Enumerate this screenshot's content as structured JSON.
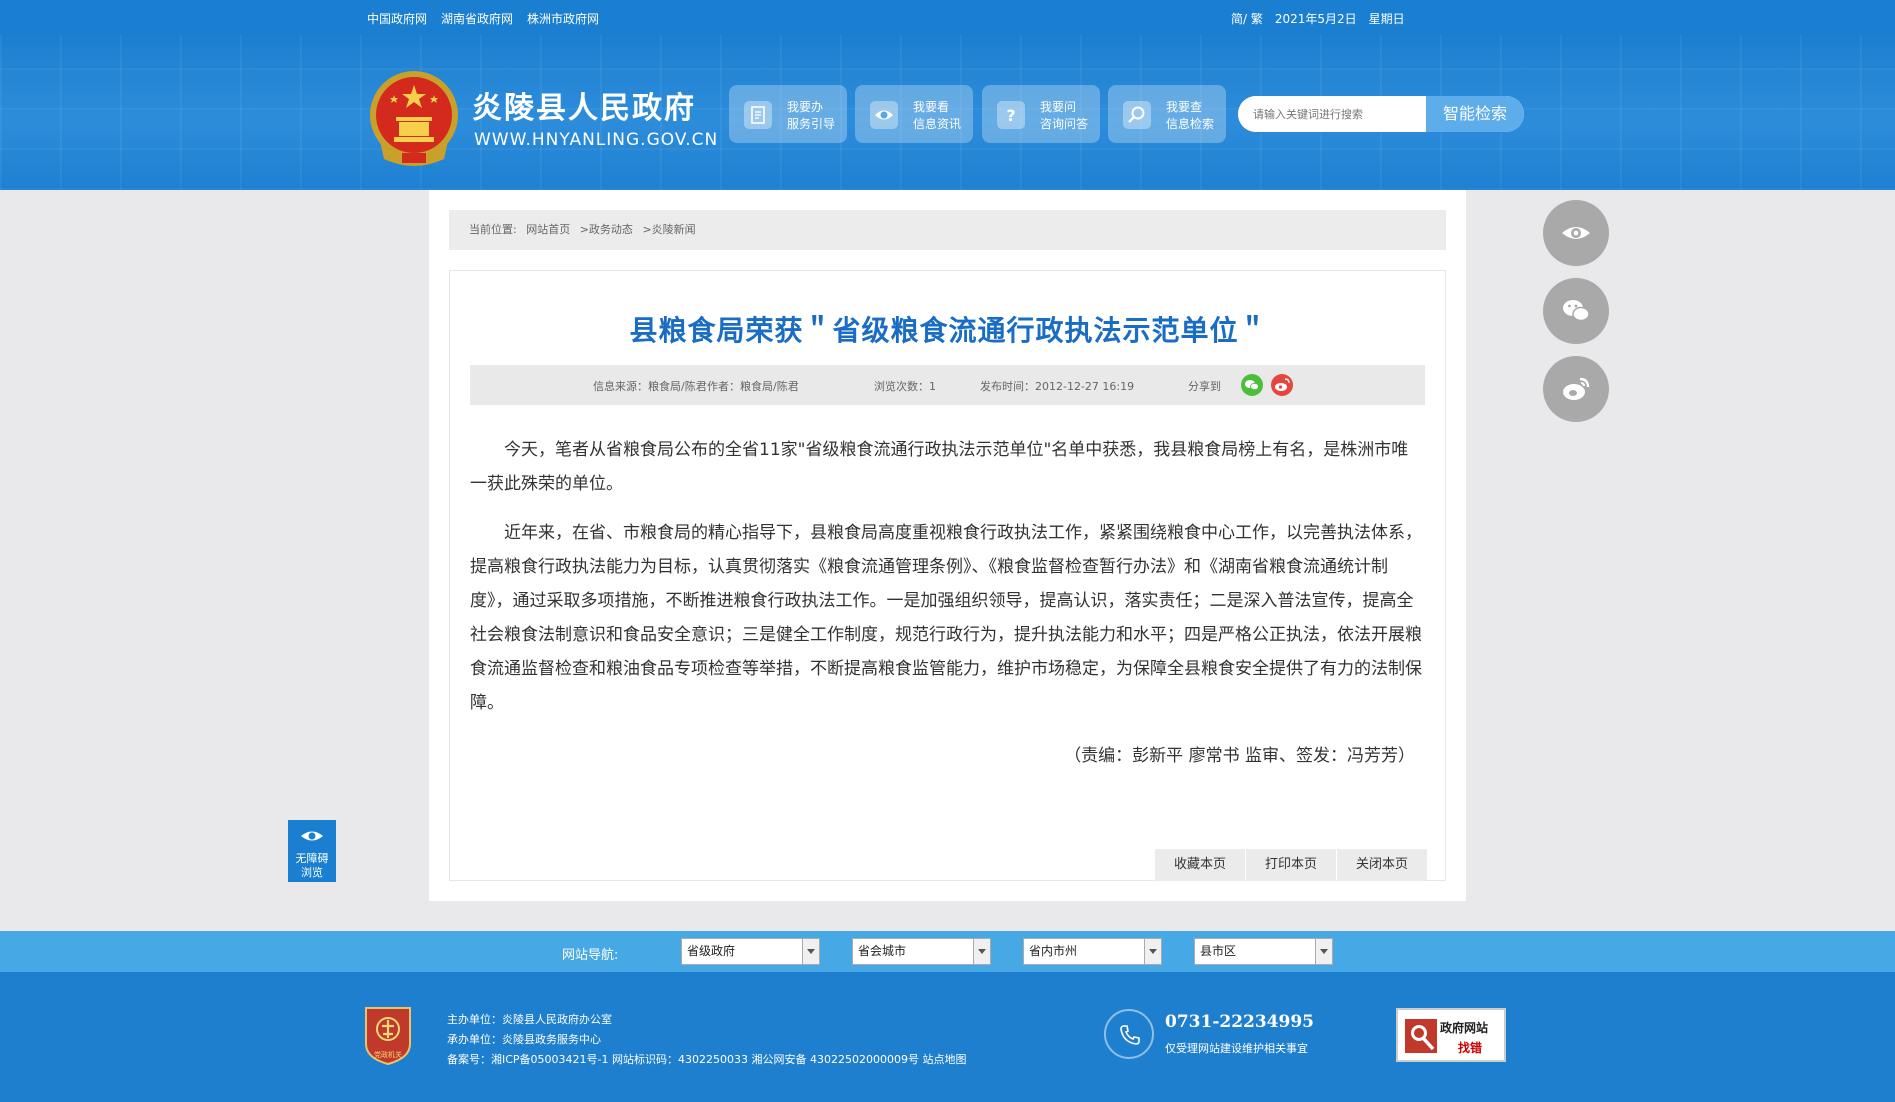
{
  "topbar": {
    "links": [
      "中国政府网",
      "湖南省政府网",
      "株洲市政府网"
    ],
    "lang": "简/ 繁",
    "date": "2021年5月2日",
    "weekday": "星期日"
  },
  "header": {
    "title": "炎陵县人民政府",
    "url": "WWW.HNYANLING.GOV.CN",
    "nav": [
      {
        "line1": "我要办",
        "line2": "服务引导",
        "icon": "document-icon"
      },
      {
        "line1": "我要看",
        "line2": "信息资讯",
        "icon": "eye-icon"
      },
      {
        "line1": "我要问",
        "line2": "咨询问答",
        "icon": "question-icon"
      },
      {
        "line1": "我要查",
        "line2": "信息检索",
        "icon": "search-icon"
      }
    ],
    "search_placeholder": "请输入关键词进行搜索",
    "search_button": "智能检索"
  },
  "breadcrumb": {
    "label": "当前位置:",
    "items": [
      "网站首页",
      ">政务动态",
      ">炎陵新闻"
    ]
  },
  "article": {
    "title": "县粮食局荣获＂省级粮食流通行政执法示范单位＂",
    "meta": {
      "source": "信息来源：粮食局/陈君",
      "author": "作者：粮食局/陈君",
      "views": "浏览次数：1",
      "published": "发布时间：2012-12-27 16:19",
      "share": "分享到"
    },
    "paragraphs": [
      "今天，笔者从省粮食局公布的全省11家\"省级粮食流通行政执法示范单位\"名单中获悉，我县粮食局榜上有名，是株洲市唯一获此殊荣的单位。",
      "近年来，在省、市粮食局的精心指导下，县粮食局高度重视粮食行政执法工作，紧紧围绕粮食中心工作，以完善执法体系，提高粮食行政执法能力为目标，认真贯彻落实《粮食流通管理条例》、《粮食监督检查暂行办法》和《湖南省粮食流通统计制度》，通过采取多项措施，不断推进粮食行政执法工作。一是加强组织领导，提高认识，落实责任；二是深入普法宣传，提高全社会粮食法制意识和食品安全意识；三是健全工作制度，规范行政行为，提升执法能力和水平；四是严格公正执法，依法开展粮食流通监督检查和粮油食品专项检查等举措，不断提高粮食监管能力，维护市场稳定，为保障全县粮食安全提供了有力的法制保障。"
    ],
    "editor": "（责编：彭新平 廖常书 监审、签发：冯芳芳）",
    "actions": [
      "收藏本页",
      "打印本页",
      "关闭本页"
    ]
  },
  "floats": [
    "eye-icon",
    "wechat-icon",
    "weibo-icon"
  ],
  "accessibility": {
    "line1": "无障碍",
    "line2": "浏览"
  },
  "sitenav": {
    "label": "网站导航:",
    "selects": [
      "省级政府",
      "省会城市",
      "省内市州",
      "县市区"
    ]
  },
  "footer": {
    "badge": "党政机关",
    "host": "主办单位：炎陵县人民政府办公室",
    "organizer": "承办单位：炎陵县政务服务中心",
    "record": "备案号：湘ICP备05003421号-1 网站标识码：4302250033 湘公网安备 43022502000009号 站点地图",
    "phone": "0731-22234995",
    "phone_note": "仅受理网站建设维护相关事宜",
    "report_line1": "政府网站",
    "report_line2": "找错"
  },
  "colors": {
    "brand_blue": "#1a7fd1",
    "title_blue": "#1a6dc4",
    "nav_bar": "#47a8e6"
  }
}
